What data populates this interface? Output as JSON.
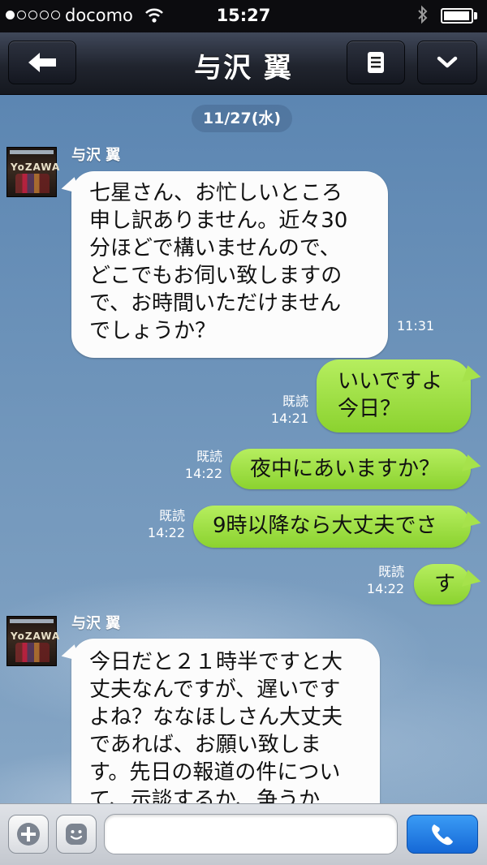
{
  "status_bar": {
    "carrier": "docomo",
    "time": "15:27",
    "signal_bars": 1,
    "signal_total": 5,
    "battery_level": 0.85
  },
  "header": {
    "title": "与沢 翼",
    "icons": [
      "back-arrow-icon",
      "menu-icon",
      "chevron-down-icon"
    ]
  },
  "chat": {
    "date": "11/27(水)",
    "messages": [
      {
        "direction": "in",
        "sender": "与沢 翼",
        "lines": [
          "七星さん、お忙しいところ",
          "申し訳ありません。近々30",
          "分ほどで構いませんので、",
          "どこでもお伺い致しますの",
          "で、お時間いただけません",
          "でしょうか？"
        ],
        "time": "11:31"
      },
      {
        "direction": "out",
        "lines": [
          "いいですよ",
          "今日？"
        ],
        "read": "既読",
        "time": "14:21"
      },
      {
        "direction": "out",
        "lines": [
          "夜中にあいますか？"
        ],
        "read": "既読",
        "time": "14:22"
      },
      {
        "direction": "out",
        "lines": [
          "9時以降なら大丈夫でさ"
        ],
        "read": "既読",
        "time": "14:22"
      },
      {
        "direction": "out",
        "lines": [
          "す"
        ],
        "read": "既読",
        "time": "14:22"
      },
      {
        "direction": "in",
        "sender": "与沢 翼",
        "lines": [
          "今日だと２１時半ですと大",
          "丈夫なんですが、遅いです",
          "よね？ななほしさん大丈夫",
          "であれば、お願い致しま",
          "す。先日の報道の件につい",
          "て、示談するか、争うか"
        ]
      }
    ]
  },
  "input_bar": {
    "placeholder": "",
    "icons": [
      "plus-icon",
      "emoji-icon",
      "phone-icon"
    ]
  },
  "colors": {
    "outgoing_bubble": "#9fde45",
    "incoming_bubble": "#fcfcfc",
    "chat_background": "#6f93b8",
    "call_button": "#1f7be6"
  }
}
